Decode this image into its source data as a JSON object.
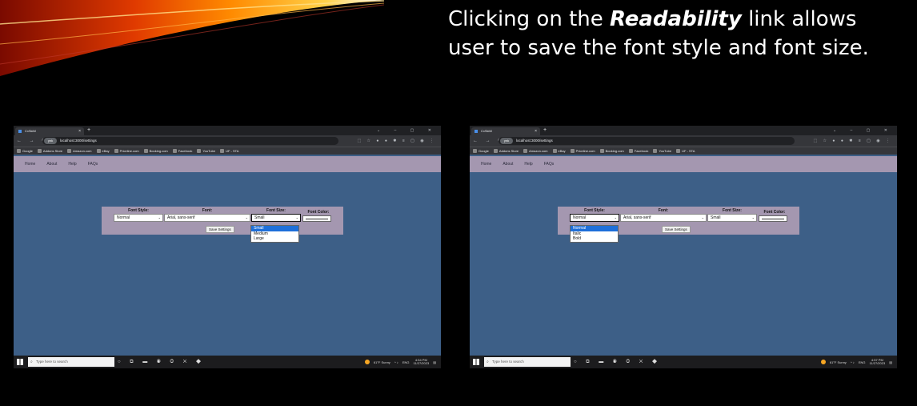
{
  "caption": {
    "before": "Clicking on the ",
    "keyword": "Readability",
    "after": " link  allows user to save the font style and font size."
  },
  "browser": {
    "tab_title": "CxSkiM",
    "tab_close": "×",
    "new_tab": "+",
    "window_controls": "⌄ – ▢ ✕",
    "nav_buttons": "← → ⟳",
    "incognito_label": "ynk",
    "url": "localhost:3000/settings",
    "bookmarks": [
      "Google",
      "Addons Store",
      "Amazon.com",
      "eBay",
      "Priceline.com",
      "Booking.com",
      "Facebook",
      "YouTube",
      "UF - STA"
    ]
  },
  "site_nav": [
    "Home",
    "About",
    "Help",
    "FAQs"
  ],
  "form": {
    "font_style_label": "Font Style:",
    "font_label": "Font:",
    "font_size_label": "Font Size:",
    "font_color_label": "Font Color:",
    "font_style_value": "Normal",
    "font_value": "Arial, sans-serif",
    "font_size_value": "Small",
    "save_label": "Save Settings"
  },
  "dropdowns": {
    "font_size_options": [
      "Small",
      "Medium",
      "Large"
    ],
    "font_style_options": [
      "Normal",
      "Italic",
      "Bold"
    ]
  },
  "taskbar": {
    "search_placeholder": "Type here to search",
    "weather": "61°F  Sunny",
    "lang": "ENG",
    "left_time": "4:54 PM",
    "right_time": "4:57 PM",
    "date": "11/27/2023"
  },
  "colors": {
    "page_bg": "#3d5f87",
    "nav_bg": "#a497b0",
    "highlight": "#1e6fd9"
  }
}
